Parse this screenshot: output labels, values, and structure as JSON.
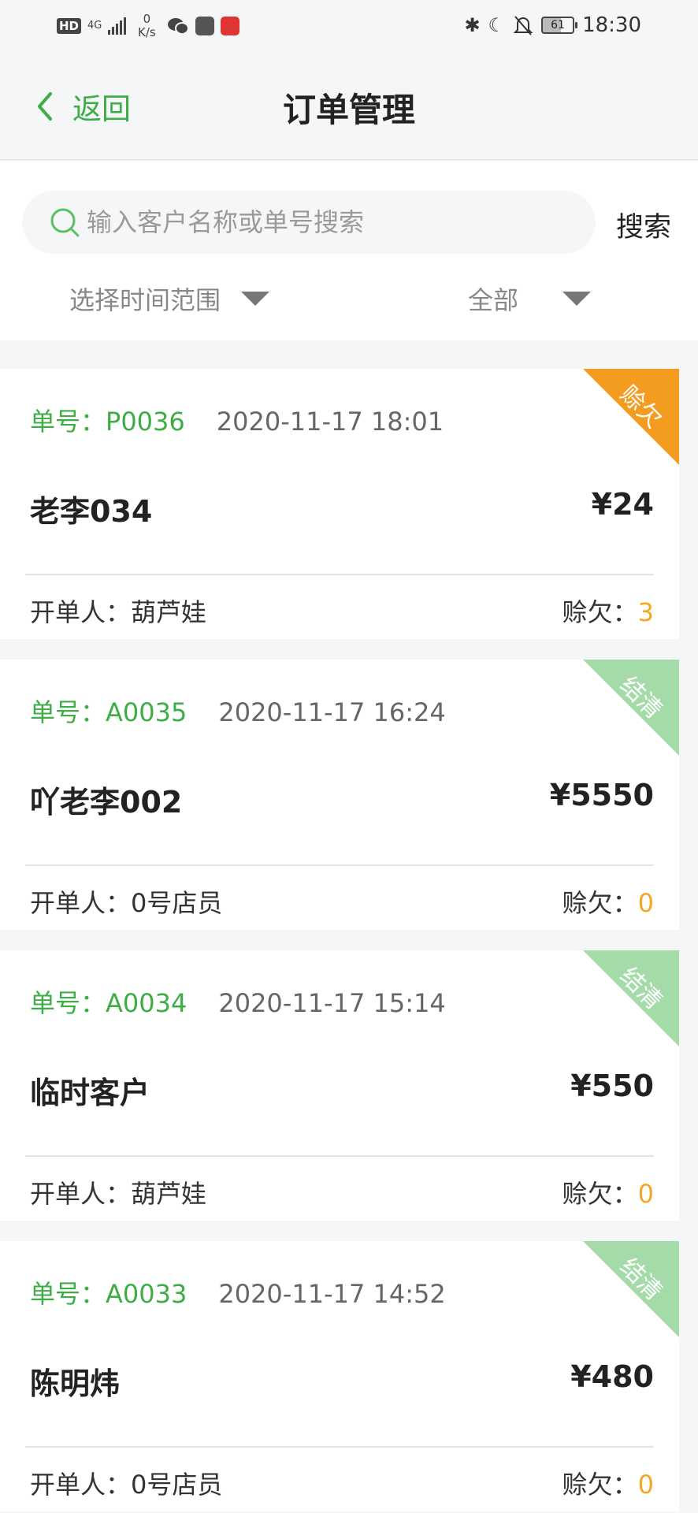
{
  "status_bar": {
    "hd": "HD",
    "network": "4G",
    "speed_value": "0",
    "speed_unit": "K/s",
    "battery": "61",
    "time": "18:30"
  },
  "header": {
    "back_label": "返回",
    "title": "订单管理"
  },
  "search": {
    "placeholder": "输入客户名称或单号搜索",
    "value": "",
    "button_label": "搜索"
  },
  "filters": {
    "time_range": "选择时间范围",
    "status": "全部"
  },
  "labels": {
    "order_no": "单号：",
    "creator": "开单人：",
    "debt": "赊欠："
  },
  "colors": {
    "accent_green": "#3cae45",
    "debt_orange": "#f5a623",
    "corner_debt": "#f39c1f",
    "corner_settled": "#a5dba9"
  },
  "orders": [
    {
      "order_no": "P0036",
      "datetime": "2020-11-17 18:01",
      "customer": "老李034",
      "amount": "¥24",
      "creator": "葫芦娃",
      "debt": "3",
      "status": "赊欠"
    },
    {
      "order_no": "A0035",
      "datetime": "2020-11-17 16:24",
      "customer": "吖老李002",
      "amount": "¥5550",
      "creator": "0号店员",
      "debt": "0",
      "status": "结清"
    },
    {
      "order_no": "A0034",
      "datetime": "2020-11-17 15:14",
      "customer": "临时客户",
      "amount": "¥550",
      "creator": "葫芦娃",
      "debt": "0",
      "status": "结清"
    },
    {
      "order_no": "A0033",
      "datetime": "2020-11-17 14:52",
      "customer": "陈明炜",
      "amount": "¥480",
      "creator": "0号店员",
      "debt": "0",
      "status": "结清"
    }
  ]
}
